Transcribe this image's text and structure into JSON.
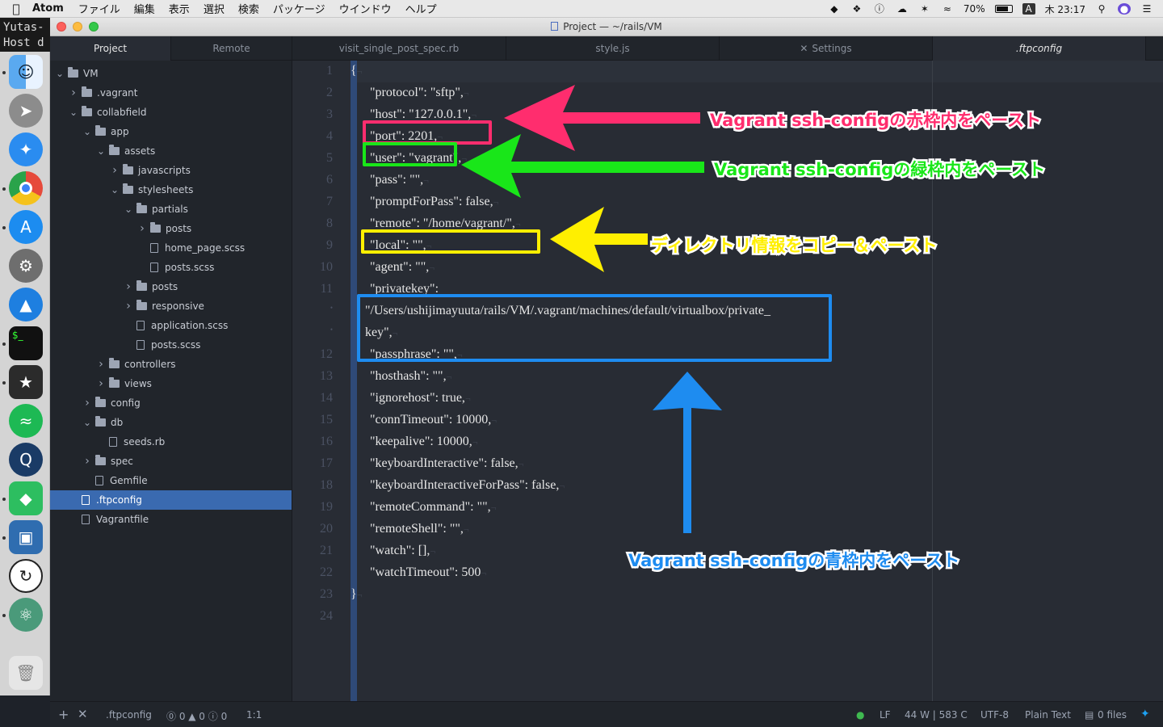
{
  "menubar": {
    "app": "Atom",
    "items": [
      "ファイル",
      "編集",
      "表示",
      "選択",
      "検索",
      "パッケージ",
      "ウインドウ",
      "ヘルプ"
    ],
    "battery": "70%",
    "ime": "A",
    "clock": "木 23:17"
  },
  "terminal_peek": [
    "Yutas-",
    "Host d"
  ],
  "window": {
    "title": "Project — ~/rails/VM"
  },
  "tabs": [
    {
      "label": "Project",
      "active": true
    },
    {
      "label": "Remote",
      "active": false
    },
    {
      "label": "visit_single_post_spec.rb",
      "active": false
    },
    {
      "label": "style.js",
      "active": false
    },
    {
      "label": "Settings",
      "active": false
    },
    {
      "label": ".ftpconfig",
      "active": true
    }
  ],
  "tree": [
    {
      "label": "VM",
      "type": "folder",
      "depth": 0,
      "open": true
    },
    {
      "label": ".vagrant",
      "type": "folder",
      "depth": 1,
      "open": false
    },
    {
      "label": "collabfield",
      "type": "folder",
      "depth": 1,
      "open": true
    },
    {
      "label": "app",
      "type": "folder",
      "depth": 2,
      "open": true
    },
    {
      "label": "assets",
      "type": "folder",
      "depth": 3,
      "open": true
    },
    {
      "label": "javascripts",
      "type": "folder",
      "depth": 4,
      "open": false
    },
    {
      "label": "stylesheets",
      "type": "folder",
      "depth": 4,
      "open": true
    },
    {
      "label": "partials",
      "type": "folder",
      "depth": 5,
      "open": true
    },
    {
      "label": "posts",
      "type": "folder",
      "depth": 6,
      "open": false
    },
    {
      "label": "home_page.scss",
      "type": "file",
      "depth": 6
    },
    {
      "label": "posts.scss",
      "type": "file",
      "depth": 6
    },
    {
      "label": "posts",
      "type": "folder",
      "depth": 5,
      "open": false
    },
    {
      "label": "responsive",
      "type": "folder",
      "depth": 5,
      "open": false
    },
    {
      "label": "application.scss",
      "type": "file",
      "depth": 5
    },
    {
      "label": "posts.scss",
      "type": "file",
      "depth": 5
    },
    {
      "label": "controllers",
      "type": "folder",
      "depth": 3,
      "open": false
    },
    {
      "label": "views",
      "type": "folder",
      "depth": 3,
      "open": false
    },
    {
      "label": "config",
      "type": "folder",
      "depth": 2,
      "open": false
    },
    {
      "label": "db",
      "type": "folder",
      "depth": 2,
      "open": true
    },
    {
      "label": "seeds.rb",
      "type": "file",
      "depth": 3
    },
    {
      "label": "spec",
      "type": "folder",
      "depth": 2,
      "open": false
    },
    {
      "label": "Gemfile",
      "type": "file",
      "depth": 2
    },
    {
      "label": ".ftpconfig",
      "type": "file",
      "depth": 1,
      "selected": true
    },
    {
      "label": "Vagrantfile",
      "type": "file",
      "depth": 1
    }
  ],
  "gutter": [
    "1",
    "2",
    "3",
    "4",
    "5",
    "6",
    "7",
    "8",
    "9",
    "10",
    "11",
    "•",
    "•",
    "12",
    "13",
    "14",
    "15",
    "16",
    "17",
    "18",
    "19",
    "20",
    "21",
    "22",
    "23",
    "24"
  ],
  "code_lines": [
    "{",
    "\"protocol\": \"sftp\",",
    "\"host\": \"127.0.0.1\",",
    "\"port\": 2201,",
    "\"user\": \"vagrant\",",
    "\"pass\": \"\",",
    "\"promptForPass\": false,",
    "\"remote\": \"/home/vagrant/\",",
    "\"local\": \"\",",
    "\"agent\": \"\",",
    "\"privatekey\":",
    "\"/Users/ushijimayuuta/rails/VM/.vagrant/machines/default/virtualbox/private_",
    "key\",",
    "\"passphrase\": \"\",",
    "\"hosthash\": \"\",",
    "\"ignorehost\": true,",
    "\"connTimeout\": 10000,",
    "\"keepalive\": 10000,",
    "\"keyboardInteractive\": false,",
    "\"keyboardInteractiveForPass\": false,",
    "\"remoteCommand\": \"\",",
    "\"remoteShell\": \"\",",
    "\"watch\": [],",
    "\"watchTimeout\": 500",
    "}",
    ""
  ],
  "annotations": {
    "red": "Vagrant ssh-configの赤枠内をペースト",
    "green": "Vagrant ssh-configの緑枠内をペースト",
    "yellow": "ディレクトリ情報をコピー＆ペースト",
    "blue": "Vagrant ssh-configの青枠内をペースト"
  },
  "colors": {
    "red": "#ff2d6e",
    "green": "#19e619",
    "yellow": "#ffef00",
    "blue": "#1e8cf0"
  },
  "statusbar": {
    "file": ".ftpconfig",
    "issues": "⓪ 0 ▲ 0 ⓘ 0",
    "cursor": "1:1",
    "line_ending": "LF",
    "counts": "44 W | 583 C",
    "encoding": "UTF-8",
    "grammar": "Plain Text",
    "git": "0 files"
  }
}
